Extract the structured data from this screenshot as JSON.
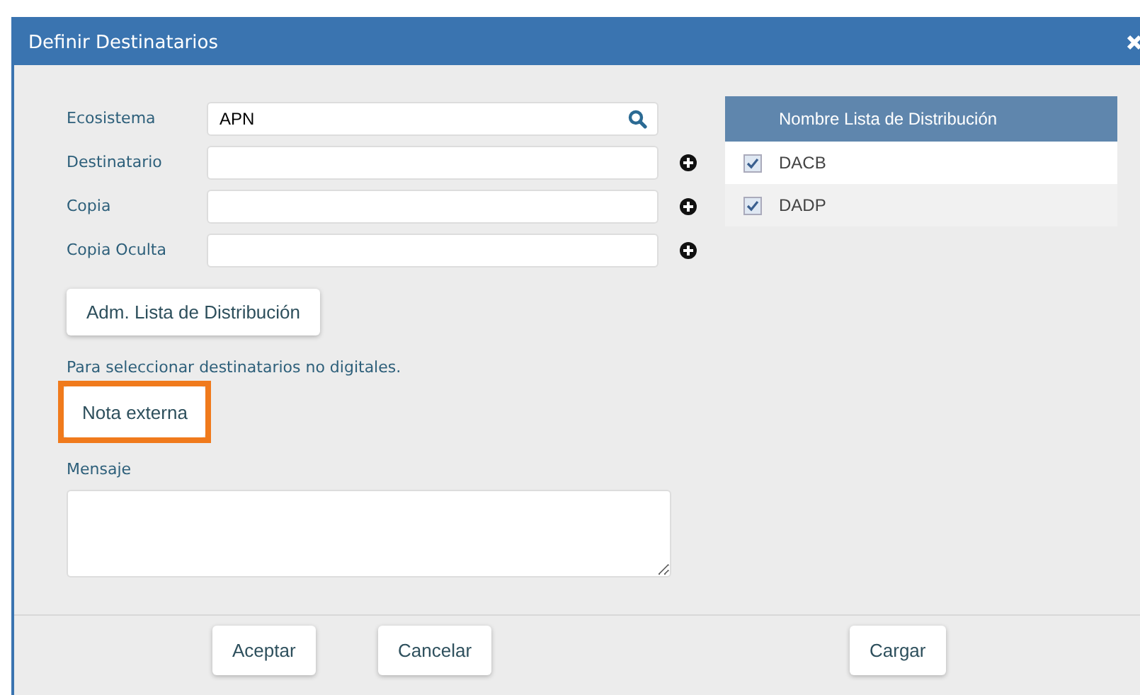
{
  "window": {
    "title": "Definir Destinatarios"
  },
  "fields": [
    {
      "label": "Ecosistema",
      "value": "APN",
      "kind": "search"
    },
    {
      "label": "Destinatario",
      "kind": "add"
    },
    {
      "label": "Copia",
      "kind": "add"
    },
    {
      "label": "Copia Oculta",
      "kind": "add"
    }
  ],
  "manage_button": "Adm. Lista de Distribución",
  "hint": "Para seleccionar destinatarios no digitales.",
  "external_button": {
    "label": "Nota externa",
    "highlighted": true
  },
  "message": {
    "label": "Mensaje"
  },
  "table": {
    "columns": [
      "Nombre Lista de Distribución"
    ],
    "rows": [
      {
        "name": "DACB",
        "checked": true
      },
      {
        "name": "DADP",
        "checked": true
      }
    ]
  },
  "buttons": [
    "Aceptar",
    "Cancelar",
    "Cargar"
  ]
}
